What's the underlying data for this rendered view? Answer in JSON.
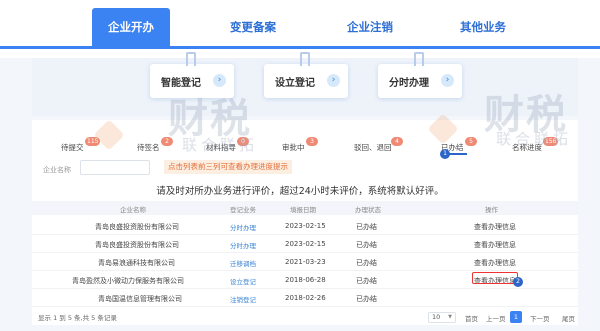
{
  "nav": {
    "tabs": [
      {
        "label": "企业开办",
        "active": true
      },
      {
        "label": "变更备案",
        "active": false
      },
      {
        "label": "企业注销",
        "active": false
      },
      {
        "label": "其他业务",
        "active": false
      }
    ]
  },
  "cards": [
    {
      "label": "智能登记",
      "icon": "arrow-right-icon"
    },
    {
      "label": "设立登记",
      "icon": "arrow-right-icon"
    },
    {
      "label": "分时办理",
      "icon": "arrow-right-icon"
    }
  ],
  "status": [
    {
      "label": "待提交",
      "count": "115"
    },
    {
      "label": "待签名",
      "count": "2"
    },
    {
      "label": "材料指导",
      "count": "0"
    },
    {
      "label": "审批中",
      "count": "3"
    },
    {
      "label": "驳回、退回",
      "count": "4"
    },
    {
      "label": "已办结",
      "count": "5"
    },
    {
      "label": "名称进度",
      "count": "156"
    }
  ],
  "filter": {
    "company_label": "企业名称",
    "company_placeholder": ""
  },
  "warning": "点击列表前三列可查看办理进度提示",
  "notice": "请及时对所办业务进行评价，超过24小时未评价，系统将默认好评。",
  "table": {
    "headers": [
      "企业名称",
      "登记业务",
      "填报日期",
      "办理状态",
      "操作"
    ],
    "rows": [
      {
        "name": "青岛良盛投资股份有限公司",
        "type": "分时办理",
        "date": "2023-02-15",
        "status": "已办结",
        "action": "查看办理信息"
      },
      {
        "name": "青岛良盛投资股份有限公司",
        "type": "分时办理",
        "date": "2023-02-15",
        "status": "已办结",
        "action": "查看办理信息"
      },
      {
        "name": "青岛易浪通科技有限公司",
        "type": "迁移调档",
        "date": "2021-03-23",
        "status": "已办结",
        "action": "查看办理信息"
      },
      {
        "name": "青岛盈然及小微动力保服务有限公司",
        "type": "设立登记",
        "date": "2018-06-28",
        "status": "已办结",
        "action": "查看办理信息"
      },
      {
        "name": "青岛国温信息管理有限公司",
        "type": "注销登记",
        "date": "2018-02-26",
        "status": "已办结",
        "action": ""
      }
    ]
  },
  "callouts": {
    "step1": "1",
    "step2": "2"
  },
  "footer": {
    "summary": "显示 1 到 5 条,共 5 条记录",
    "page_size": "10",
    "first": "首页",
    "prev": "上一页",
    "current": "1",
    "next": "下一页",
    "last": "尾页"
  },
  "watermark": {
    "main": "财税",
    "sub": "联合联拓"
  },
  "colors": {
    "primary": "#3b82f2",
    "badge": "#f08a74",
    "warn_text": "#e46f3a",
    "highlight": "#e33"
  }
}
